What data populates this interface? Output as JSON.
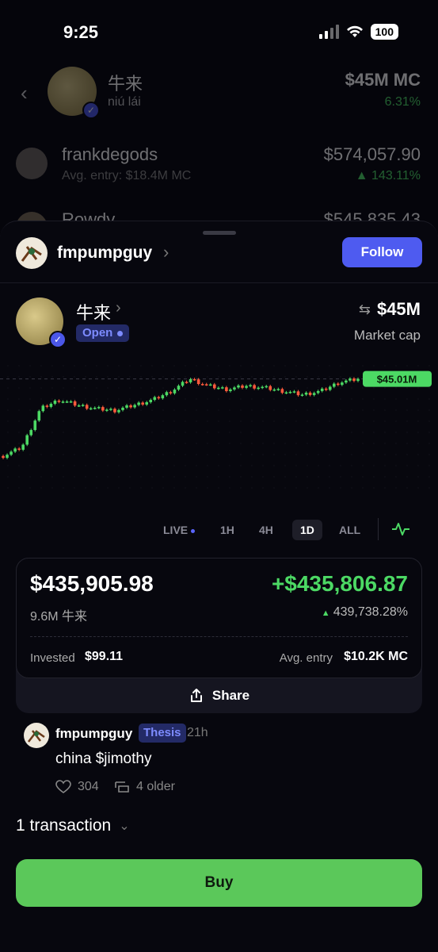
{
  "status_bar": {
    "time": "9:25",
    "battery": "100"
  },
  "background_list": {
    "header": {
      "name": "牛来",
      "sub": "niú lái",
      "market_cap": "$45M MC",
      "change": "6.31%"
    },
    "rows": [
      {
        "name": "frankdegods",
        "sub": "Avg. entry: $18.4M MC",
        "value": "$574,057.90",
        "change": "143.11%"
      },
      {
        "name": "Rowdy",
        "value": "$545,835.43"
      }
    ]
  },
  "sheet": {
    "user": {
      "name": "fmpumpguy",
      "follow_label": "Follow"
    },
    "token": {
      "name": "牛来",
      "status": "Open",
      "market_cap": "$45M",
      "market_cap_label": "Market cap"
    },
    "chart_data": {
      "type": "line",
      "current_label": "$45.01M",
      "x": [
        "t1",
        "t2",
        "t3",
        "t4",
        "t5",
        "t6",
        "t7",
        "t8",
        "t9",
        "t10",
        "t11",
        "t12",
        "t13",
        "t14",
        "t15",
        "t16",
        "t17",
        "t18",
        "t19",
        "t20"
      ],
      "values": [
        1.0,
        6.0,
        28.0,
        33.0,
        30.0,
        28.0,
        27.0,
        30.0,
        33.0,
        38.0,
        45.0,
        41.0,
        39.0,
        41.0,
        40.0,
        38.0,
        36.0,
        38.0,
        43.0,
        45.0
      ]
    },
    "ranges": [
      "LIVE",
      "1H",
      "4H",
      "1D",
      "ALL"
    ],
    "active_range": "1D",
    "position": {
      "value": "$435,905.98",
      "pnl": "+$435,806.87",
      "holdings": "9.6M 牛来",
      "pnl_pct": "439,738.28%",
      "invested_label": "Invested",
      "invested_value": "$99.11",
      "avg_entry_label": "Avg. entry",
      "avg_entry_value": "$10.2K MC",
      "share_label": "Share"
    },
    "thesis": {
      "author": "fmpumpguy",
      "badge": "Thesis",
      "time": "21h",
      "text": "china $jimothy",
      "likes": "304",
      "older": "4 older"
    },
    "transactions_label": "1 transaction",
    "buy_label": "Buy"
  },
  "colors": {
    "accent": "#4e5bf0",
    "positive": "#4cd964",
    "negative": "#ff5a3c",
    "buy": "#5bc85a"
  }
}
